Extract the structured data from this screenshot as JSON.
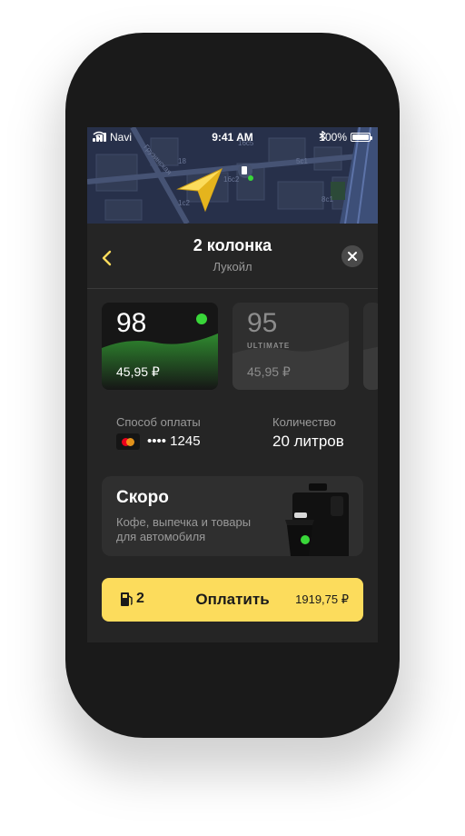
{
  "status_bar": {
    "carrier": "Navi",
    "time": "9:41 AM",
    "battery": "100%"
  },
  "map": {
    "street_label": "Грузинская",
    "building_labels": [
      "16с5",
      "18",
      "5с1",
      "16с2",
      "8с1",
      "1с2"
    ]
  },
  "header": {
    "title": "2 колонка",
    "subtitle": "Лукойл"
  },
  "fuels": [
    {
      "number": "98",
      "sub": "",
      "price": "45,95 ₽",
      "selected": true
    },
    {
      "number": "95",
      "sub": "ULTIMATE",
      "price": "45,95 ₽",
      "selected": false
    }
  ],
  "payment": {
    "label": "Способ оплаты",
    "card_number": "•••• 1245",
    "card_brand_icon": "mastercard-icon"
  },
  "quantity": {
    "label": "Количество",
    "value": "20 литров"
  },
  "promo": {
    "title": "Скоро",
    "text": "Кофе, выпечка и товары для автомобиля"
  },
  "pay_button": {
    "pump_number": "2",
    "label": "Оплатить",
    "price": "1919,75 ₽"
  },
  "colors": {
    "accent": "#fcdc5c",
    "status_green": "#39d639",
    "panel_bg": "#252525"
  }
}
